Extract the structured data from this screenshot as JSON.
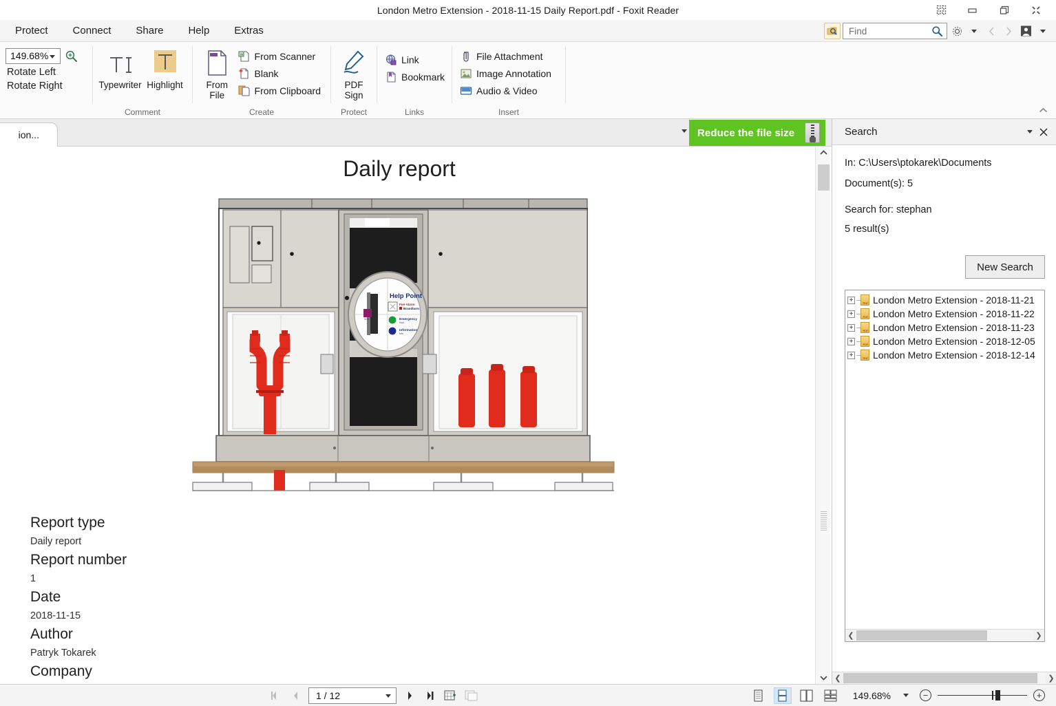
{
  "window": {
    "title": "London Metro Extension -  2018-11-15 Daily Report.pdf - Foxit Reader",
    "controls": [
      "restore-grid",
      "minimize",
      "maximize",
      "close"
    ]
  },
  "menubar": {
    "items": [
      {
        "label": "Protect",
        "name": "menu-protect"
      },
      {
        "label": "Connect",
        "name": "menu-connect"
      },
      {
        "label": "Share",
        "name": "menu-share"
      },
      {
        "label": "Help",
        "name": "menu-help"
      },
      {
        "label": "Extras",
        "name": "menu-extras"
      }
    ]
  },
  "find": {
    "placeholder": "Find",
    "value": ""
  },
  "ribbon": {
    "zoom": {
      "value": "149.68%",
      "rotate_left": "Rotate Left",
      "rotate_right": "Rotate Right"
    },
    "groups": [
      {
        "label": "Comment",
        "buttons": [
          {
            "label": "Typewriter",
            "icon": "typewriter-icon"
          },
          {
            "label": "Highlight",
            "icon": "highlight-icon"
          }
        ]
      },
      {
        "label": "Create",
        "big": {
          "label": "From\nFile",
          "line1": "From",
          "line2": "File",
          "icon": "from-file-icon"
        },
        "items": [
          {
            "label": "From Scanner",
            "icon": "scanner-icon"
          },
          {
            "label": "Blank",
            "icon": "blank-page-icon"
          },
          {
            "label": "From Clipboard",
            "icon": "clipboard-icon"
          }
        ]
      },
      {
        "label": "Protect",
        "big": {
          "line1": "PDF",
          "line2": "Sign",
          "icon": "pdf-sign-icon"
        }
      },
      {
        "label": "Links",
        "items": [
          {
            "label": "Link",
            "icon": "link-globe-icon"
          },
          {
            "label": "Bookmark",
            "icon": "bookmark-icon"
          }
        ]
      },
      {
        "label": "Insert",
        "items": [
          {
            "label": "File Attachment",
            "icon": "paperclip-icon"
          },
          {
            "label": "Image Annotation",
            "icon": "image-icon"
          },
          {
            "label": "Audio & Video",
            "icon": "media-icon"
          }
        ]
      }
    ]
  },
  "tabs": {
    "active_label": "ion...",
    "close_label": "×"
  },
  "banner": {
    "label": "Reduce the file size"
  },
  "document": {
    "page_title": "Daily report",
    "illustration_alt": "metro equipment cabinet with help point, fire hydrant and extinguishers",
    "help_point_label": "Help Point",
    "help_point_items": [
      "Fire Alarm",
      "Emergency",
      "Information"
    ],
    "fields": [
      {
        "label": "Report type",
        "value": "Daily report"
      },
      {
        "label": "Report number",
        "value": "1"
      },
      {
        "label": "Date",
        "value": "2018-11-15"
      },
      {
        "label": "Author",
        "value": "Patryk Tokarek"
      },
      {
        "label": "Company",
        "value": ""
      }
    ]
  },
  "search_panel": {
    "title": "Search",
    "in_line": "In: C:\\Users\\ptokarek\\Documents",
    "documents_line": "Document(s): 5",
    "search_for_line": "Search for: stephan",
    "results_line": "5 result(s)",
    "new_search_label": "New Search",
    "results": [
      "London Metro Extension - 2018-11-21",
      "London Metro Extension - 2018-11-22",
      "London Metro Extension - 2018-11-23",
      "London Metro Extension - 2018-12-05",
      "London Metro Extension - 2018-12-14"
    ]
  },
  "statusbar": {
    "page_value": "1 / 12",
    "zoom_value": "149.68%",
    "view_modes": [
      "single-page-view",
      "continuous-view",
      "facing-view",
      "continuous-facing-view"
    ],
    "active_view_mode": "continuous-view"
  },
  "colors": {
    "banner_green": "#5fc321",
    "accent_blue": "#2a6099",
    "hydrant_red": "#e02b1d",
    "highlight_tan": "#edcb8a"
  }
}
